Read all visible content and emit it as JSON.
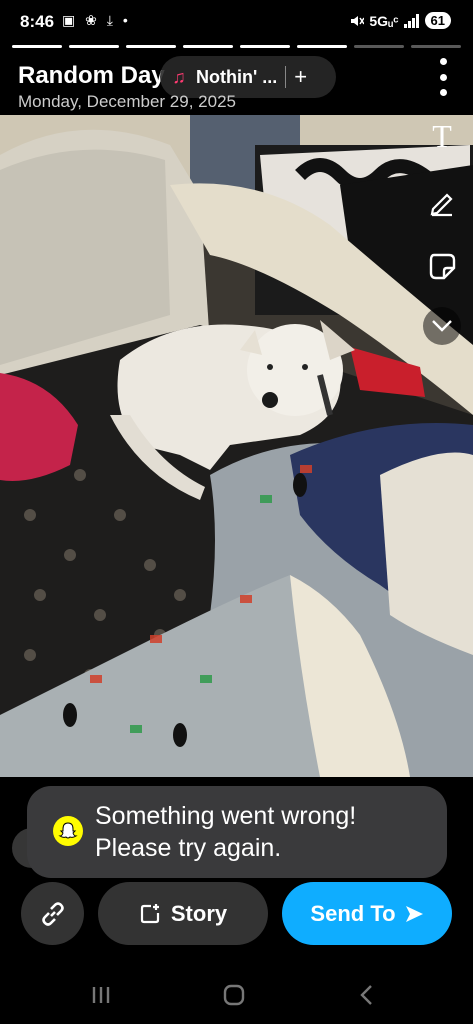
{
  "status_bar": {
    "time": "8:46",
    "left_icons": "▣ ❀ ⤓ •",
    "network": "5Gᵤᶜ",
    "battery": "61"
  },
  "story_progress": {
    "total": 8,
    "current": 6
  },
  "header": {
    "title": "Random Day",
    "song": "Nothin' ...",
    "add_symbol": "+",
    "date": "Monday, December 29, 2025"
  },
  "tools": {
    "text_tool": "T"
  },
  "toast": {
    "line1": "Something went wrong!",
    "line2": "Please try again."
  },
  "actions": {
    "story_label": "Story",
    "send_label": "Send To"
  },
  "colors": {
    "send_blue": "#0fadff",
    "snap_yellow": "#fffc00",
    "button_gray": "#333333"
  }
}
